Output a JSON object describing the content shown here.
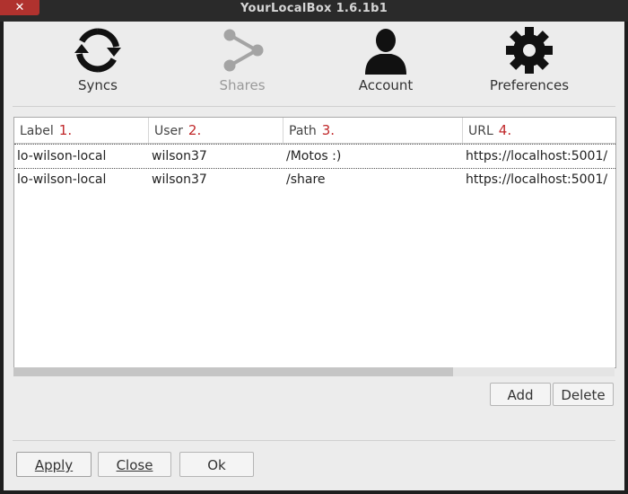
{
  "window": {
    "title": "YourLocalBox 1.6.1b1",
    "close_glyph": "✕"
  },
  "toolbar": {
    "syncs": {
      "label": "Syncs",
      "icon": "sync-icon"
    },
    "shares": {
      "label": "Shares",
      "icon": "share-icon"
    },
    "account": {
      "label": "Account",
      "icon": "user-icon"
    },
    "preferences": {
      "label": "Preferences",
      "icon": "gear-icon"
    }
  },
  "table": {
    "columns": [
      {
        "label": "Label",
        "num": "1."
      },
      {
        "label": "User",
        "num": "2."
      },
      {
        "label": "Path",
        "num": "3."
      },
      {
        "label": "URL",
        "num": "4."
      }
    ],
    "rows": [
      {
        "label": "lo-wilson-local",
        "user": "wilson37",
        "path": "/Motos :)",
        "url": "https://localhost:5001/"
      },
      {
        "label": "lo-wilson-local",
        "user": "wilson37",
        "path": "/share",
        "url": "https://localhost:5001/"
      }
    ]
  },
  "actions": {
    "add": "Add",
    "delete": "Delete"
  },
  "footer": {
    "apply": "Apply",
    "close": "Close",
    "ok": "Ok"
  },
  "colors": {
    "accent_number": "#c0282a",
    "close_button": "#b0322e",
    "titlebar": "#2a2a2a"
  }
}
